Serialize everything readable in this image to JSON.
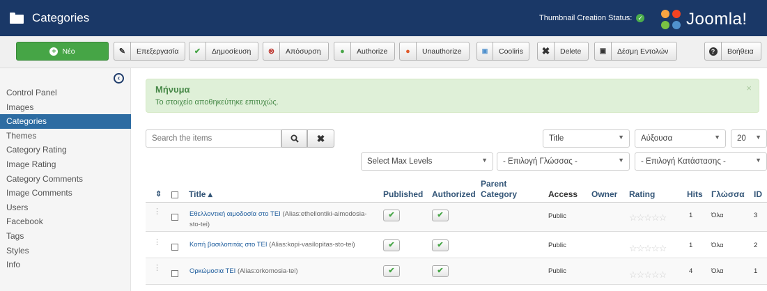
{
  "header": {
    "title": "Categories",
    "status_label": "Thumbnail Creation Status:",
    "logo_text": "Joomla!"
  },
  "toolbar": {
    "new": "Νέο",
    "edit": "Επεξεργασία",
    "publish": "Δημοσίευση",
    "unpublish": "Απόσυρση",
    "authorize": "Authorize",
    "unauthorize": "Unauthorize",
    "cooliris": "Cooliris",
    "delete": "Delete",
    "batch": "Δέσμη Εντολών",
    "help": "Βοήθεια"
  },
  "sidebar": {
    "items": [
      "Control Panel",
      "Images",
      "Categories",
      "Themes",
      "Category Rating",
      "Image Rating",
      "Category Comments",
      "Image Comments",
      "Users",
      "Facebook",
      "Tags",
      "Styles",
      "Info"
    ],
    "active": "Categories"
  },
  "alert": {
    "heading": "Μήνυμα",
    "message": "Το στοιχείο αποθηκεύτηκε επιτυχώς."
  },
  "filters": {
    "search_placeholder": "Search the items",
    "sort_field": "Title",
    "sort_dir": "Αύξουσα",
    "limit": "20",
    "max_levels": "Select Max Levels",
    "language": "- Επιλογή Γλώσσας -",
    "state": "- Επιλογή Κατάστασης -"
  },
  "table": {
    "headers": {
      "title": "Title ▴",
      "published": "Published",
      "authorized": "Authorized",
      "parent1": "Parent",
      "parent2": "Category",
      "access": "Access",
      "owner": "Owner",
      "rating": "Rating",
      "hits": "Hits",
      "language": "Γλώσσα",
      "id": "ID"
    },
    "rows": [
      {
        "title": "Εθελλοντική αιμοδοσία στο ΤΕΙ",
        "alias1": " (Alias:ethellontiki-aimodosia-",
        "alias2": "sto-tei)",
        "access": "Public",
        "hits": "1",
        "language": "Όλα",
        "id": "3"
      },
      {
        "title": "Κοπή βασιλοπιτάς στο ΤΕΙ",
        "alias1": " (Alias:kopi-vasilopitas-sto-tei)",
        "alias2": "",
        "access": "Public",
        "hits": "1",
        "language": "Όλα",
        "id": "2"
      },
      {
        "title": "Ορκώμοσια ΤΕΙ",
        "alias1": " (Alias:orkomosia-tei)",
        "alias2": "",
        "access": "Public",
        "hits": "4",
        "language": "Όλα",
        "id": "1"
      }
    ]
  },
  "colors": {
    "header_bg": "#1a3867",
    "new_button": "#46a546",
    "active_sidebar": "#2d6ca2",
    "alert_bg": "#dff0d8"
  }
}
